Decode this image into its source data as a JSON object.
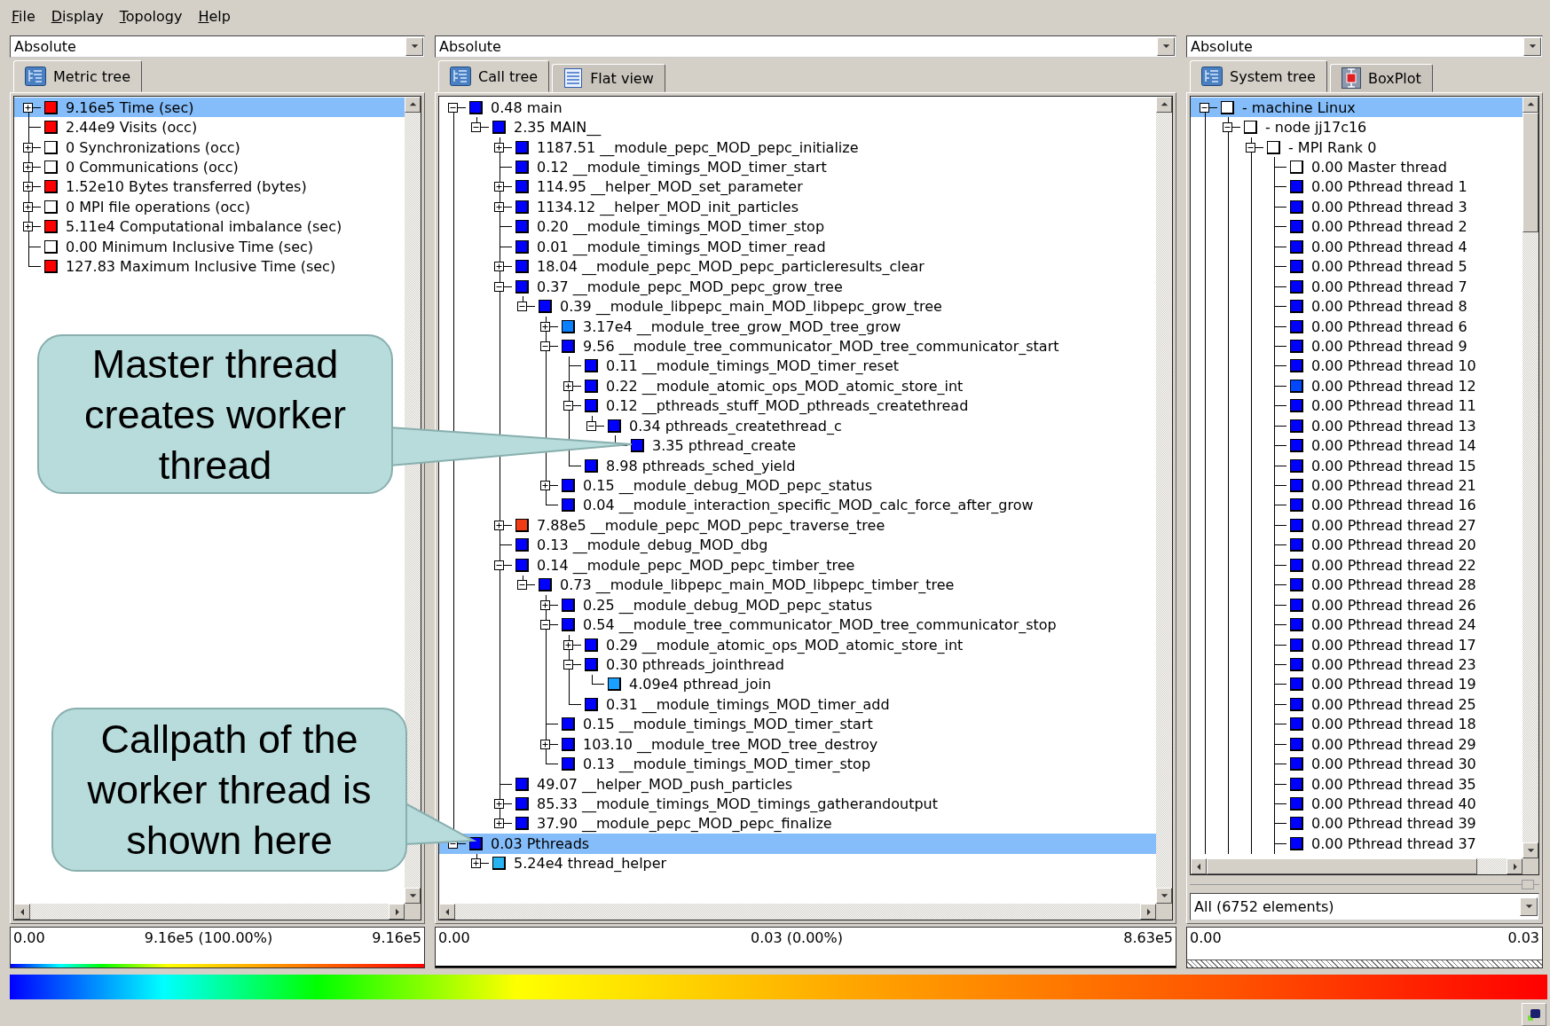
{
  "menu": [
    "File",
    "Display",
    "Topology",
    "Help"
  ],
  "panels": [
    {
      "dropdown": "Absolute",
      "tabs": [
        {
          "label": "Metric tree",
          "kind": "tree",
          "selected": true
        }
      ],
      "tree": {
        "clipped": false,
        "nodes": [
          {
            "label": "9.16e5 Time (sec)",
            "color": "#ff0000",
            "selected": true,
            "expanded": false
          },
          {
            "label": "2.44e9 Visits (occ)",
            "color": "#ff0000",
            "selected": false
          },
          {
            "label": "0 Synchronizations (occ)",
            "color": "#ffffff",
            "selected": false,
            "expanded": false
          },
          {
            "label": "0 Communications (occ)",
            "color": "#ffffff",
            "selected": false,
            "expanded": false
          },
          {
            "label": "1.52e10 Bytes transferred (bytes)",
            "color": "#ff0000",
            "selected": false,
            "expanded": false
          },
          {
            "label": "0 MPI file operations (occ)",
            "color": "#ffffff",
            "selected": false,
            "expanded": false
          },
          {
            "label": "5.11e4 Computational imbalance (sec)",
            "color": "#ff0000",
            "selected": false,
            "expanded": false
          },
          {
            "label": "0.00 Minimum Inclusive Time (sec)",
            "color": "#ffffff",
            "selected": false
          },
          {
            "label": "127.83 Maximum Inclusive Time (sec)",
            "color": "#ff0000",
            "selected": false
          }
        ]
      },
      "value_bar": {
        "kind": "gradient",
        "min": "0.00",
        "current": "9.16e5 (100.00%)",
        "max": "9.16e5"
      }
    },
    {
      "dropdown": "Absolute",
      "tabs": [
        {
          "label": "Call tree",
          "kind": "tree",
          "selected": true
        },
        {
          "label": "Flat view",
          "kind": "list",
          "selected": false
        }
      ],
      "tree": {
        "clipped": false,
        "nodes": [
          {
            "label": "0.48 main",
            "color": "#0000ff",
            "selected": false,
            "expanded": true,
            "children": [
              {
                "label": "2.35 MAIN__",
                "color": "#0000ff",
                "selected": false,
                "expanded": true,
                "children": [
                  {
                    "label": "1187.51 __module_pepc_MOD_pepc_initialize",
                    "color": "#0000ff",
                    "selected": false,
                    "expanded": false
                  },
                  {
                    "label": "0.12 __module_timings_MOD_timer_start",
                    "color": "#0000ff",
                    "selected": false
                  },
                  {
                    "label": "114.95 __helper_MOD_set_parameter",
                    "color": "#0000ff",
                    "selected": false,
                    "expanded": false
                  },
                  {
                    "label": "1134.12 __helper_MOD_init_particles",
                    "color": "#0000ff",
                    "selected": false,
                    "expanded": false
                  },
                  {
                    "label": "0.20 __module_timings_MOD_timer_stop",
                    "color": "#0000ff",
                    "selected": false
                  },
                  {
                    "label": "0.01 __module_timings_MOD_timer_read",
                    "color": "#0000ff",
                    "selected": false
                  },
                  {
                    "label": "18.04 __module_pepc_MOD_pepc_particleresults_clear",
                    "color": "#0000ff",
                    "selected": false,
                    "expanded": false
                  },
                  {
                    "label": "0.37 __module_pepc_MOD_pepc_grow_tree",
                    "color": "#0000ff",
                    "selected": false,
                    "expanded": true,
                    "children": [
                      {
                        "label": "0.39 __module_libpepc_main_MOD_libpepc_grow_tree",
                        "color": "#0000ff",
                        "selected": false,
                        "expanded": true,
                        "children": [
                          {
                            "label": "3.17e4 __module_tree_grow_MOD_tree_grow",
                            "color": "#0a80ff",
                            "selected": false,
                            "expanded": false
                          },
                          {
                            "label": "9.56 __module_tree_communicator_MOD_tree_communicator_start",
                            "color": "#0000ff",
                            "selected": false,
                            "expanded": true,
                            "children": [
                              {
                                "label": "0.11 __module_timings_MOD_timer_reset",
                                "color": "#0000ff",
                                "selected": false
                              },
                              {
                                "label": "0.22 __module_atomic_ops_MOD_atomic_store_int",
                                "color": "#0000ff",
                                "selected": false,
                                "expanded": false
                              },
                              {
                                "label": "0.12 __pthreads_stuff_MOD_pthreads_createthread",
                                "color": "#0000ff",
                                "selected": false,
                                "expanded": true,
                                "children": [
                                  {
                                    "label": "0.34 pthreads_createthread_c",
                                    "color": "#0000ff",
                                    "selected": false,
                                    "expanded": true,
                                    "children": [
                                      {
                                        "label": "3.35 pthread_create",
                                        "color": "#0000ff",
                                        "selected": false
                                      }
                                    ]
                                  }
                                ]
                              },
                              {
                                "label": "8.98 pthreads_sched_yield",
                                "color": "#0000ff",
                                "selected": false
                              }
                            ]
                          },
                          {
                            "label": "0.15 __module_debug_MOD_pepc_status",
                            "color": "#0000ff",
                            "selected": false,
                            "expanded": false
                          },
                          {
                            "label": "0.04 __module_interaction_specific_MOD_calc_force_after_grow",
                            "color": "#0000ff",
                            "selected": false
                          }
                        ]
                      }
                    ]
                  },
                  {
                    "label": "7.88e5 __module_pepc_MOD_pepc_traverse_tree",
                    "color": "#f03c14",
                    "selected": false,
                    "expanded": false
                  },
                  {
                    "label": "0.13 __module_debug_MOD_dbg",
                    "color": "#0000ff",
                    "selected": false
                  },
                  {
                    "label": "0.14 __module_pepc_MOD_pepc_timber_tree",
                    "color": "#0000ff",
                    "selected": false,
                    "expanded": true,
                    "children": [
                      {
                        "label": "0.73 __module_libpepc_main_MOD_libpepc_timber_tree",
                        "color": "#0000ff",
                        "selected": false,
                        "expanded": true,
                        "children": [
                          {
                            "label": "0.25 __module_debug_MOD_pepc_status",
                            "color": "#0000ff",
                            "selected": false,
                            "expanded": false
                          },
                          {
                            "label": "0.54 __module_tree_communicator_MOD_tree_communicator_stop",
                            "color": "#0000ff",
                            "selected": false,
                            "expanded": true,
                            "children": [
                              {
                                "label": "0.29 __module_atomic_ops_MOD_atomic_store_int",
                                "color": "#0000ff",
                                "selected": false,
                                "expanded": false
                              },
                              {
                                "label": "0.30 pthreads_jointhread",
                                "color": "#0000ff",
                                "selected": false,
                                "expanded": true,
                                "children": [
                                  {
                                    "label": "4.09e4 pthread_join",
                                    "color": "#1aa0ff",
                                    "selected": false
                                  }
                                ]
                              },
                              {
                                "label": "0.31 __module_timings_MOD_timer_add",
                                "color": "#0000ff",
                                "selected": false
                              }
                            ]
                          },
                          {
                            "label": "0.15 __module_timings_MOD_timer_start",
                            "color": "#0000ff",
                            "selected": false
                          },
                          {
                            "label": "103.10 __module_tree_MOD_tree_destroy",
                            "color": "#0000ff",
                            "selected": false,
                            "expanded": false
                          },
                          {
                            "label": "0.13 __module_timings_MOD_timer_stop",
                            "color": "#0000ff",
                            "selected": false
                          }
                        ]
                      }
                    ]
                  },
                  {
                    "label": "49.07 __helper_MOD_push_particles",
                    "color": "#0000ff",
                    "selected": false
                  },
                  {
                    "label": "85.33 __module_timings_MOD_timings_gatherandoutput",
                    "color": "#0000ff",
                    "selected": false,
                    "expanded": false
                  },
                  {
                    "label": "37.90 __module_pepc_MOD_pepc_finalize",
                    "color": "#0000ff",
                    "selected": false,
                    "expanded": false
                  }
                ]
              }
            ]
          },
          {
            "label": "0.03 Pthreads",
            "color": "#0000ff",
            "selected": true,
            "expanded": true,
            "children": [
              {
                "label": "5.24e4 thread_helper",
                "color": "#28b4f0",
                "selected": false,
                "expanded": false
              }
            ]
          }
        ]
      },
      "value_bar": {
        "kind": "line",
        "min": "0.00",
        "current": "0.03 (0.00%)",
        "max": "8.63e5"
      }
    },
    {
      "dropdown": "Absolute",
      "tabs": [
        {
          "label": "System tree",
          "kind": "tree",
          "selected": true
        },
        {
          "label": "BoxPlot",
          "kind": "boxplot",
          "selected": false
        }
      ],
      "tree": {
        "clipped": true,
        "nodes": [
          {
            "label": "- machine Linux",
            "color": "#ffffff",
            "selected": true,
            "expanded": true,
            "children": [
              {
                "label": "- node jj17c16",
                "color": "#ffffff",
                "selected": false,
                "expanded": true,
                "children": [
                  {
                    "label": "- MPI Rank 0",
                    "color": "#ffffff",
                    "selected": false,
                    "expanded": true,
                    "children": [
                      {
                        "label": "0.00 Master thread",
                        "color": "#ffffff",
                        "selected": false
                      },
                      {
                        "label": "0.00 Pthread thread 1",
                        "color": "#0000ff",
                        "selected": false
                      },
                      {
                        "label": "0.00 Pthread thread 3",
                        "color": "#0000ff",
                        "selected": false
                      },
                      {
                        "label": "0.00 Pthread thread 2",
                        "color": "#0000ff",
                        "selected": false
                      },
                      {
                        "label": "0.00 Pthread thread 4",
                        "color": "#0000ff",
                        "selected": false
                      },
                      {
                        "label": "0.00 Pthread thread 5",
                        "color": "#0000ff",
                        "selected": false
                      },
                      {
                        "label": "0.00 Pthread thread 7",
                        "color": "#0000ff",
                        "selected": false
                      },
                      {
                        "label": "0.00 Pthread thread 8",
                        "color": "#0000ff",
                        "selected": false
                      },
                      {
                        "label": "0.00 Pthread thread 6",
                        "color": "#0000ff",
                        "selected": false
                      },
                      {
                        "label": "0.00 Pthread thread 9",
                        "color": "#0000ff",
                        "selected": false
                      },
                      {
                        "label": "0.00 Pthread thread 10",
                        "color": "#0000ff",
                        "selected": false
                      },
                      {
                        "label": "0.00 Pthread thread 12",
                        "color": "#0048ff",
                        "selected": false
                      },
                      {
                        "label": "0.00 Pthread thread 11",
                        "color": "#0000ff",
                        "selected": false
                      },
                      {
                        "label": "0.00 Pthread thread 13",
                        "color": "#0000ff",
                        "selected": false
                      },
                      {
                        "label": "0.00 Pthread thread 14",
                        "color": "#0000ff",
                        "selected": false
                      },
                      {
                        "label": "0.00 Pthread thread 15",
                        "color": "#0000ff",
                        "selected": false
                      },
                      {
                        "label": "0.00 Pthread thread 21",
                        "color": "#0000ff",
                        "selected": false
                      },
                      {
                        "label": "0.00 Pthread thread 16",
                        "color": "#0000ff",
                        "selected": false
                      },
                      {
                        "label": "0.00 Pthread thread 27",
                        "color": "#0000ff",
                        "selected": false
                      },
                      {
                        "label": "0.00 Pthread thread 20",
                        "color": "#0000ff",
                        "selected": false
                      },
                      {
                        "label": "0.00 Pthread thread 22",
                        "color": "#0000ff",
                        "selected": false
                      },
                      {
                        "label": "0.00 Pthread thread 28",
                        "color": "#0000ff",
                        "selected": false
                      },
                      {
                        "label": "0.00 Pthread thread 26",
                        "color": "#0000ff",
                        "selected": false
                      },
                      {
                        "label": "0.00 Pthread thread 24",
                        "color": "#0000ff",
                        "selected": false
                      },
                      {
                        "label": "0.00 Pthread thread 17",
                        "color": "#0000ff",
                        "selected": false
                      },
                      {
                        "label": "0.00 Pthread thread 23",
                        "color": "#0000ff",
                        "selected": false
                      },
                      {
                        "label": "0.00 Pthread thread 19",
                        "color": "#0000ff",
                        "selected": false
                      },
                      {
                        "label": "0.00 Pthread thread 25",
                        "color": "#0000ff",
                        "selected": false
                      },
                      {
                        "label": "0.00 Pthread thread 18",
                        "color": "#0000ff",
                        "selected": false
                      },
                      {
                        "label": "0.00 Pthread thread 29",
                        "color": "#0000ff",
                        "selected": false
                      },
                      {
                        "label": "0.00 Pthread thread 30",
                        "color": "#0000ff",
                        "selected": false
                      },
                      {
                        "label": "0.00 Pthread thread 35",
                        "color": "#0000ff",
                        "selected": false
                      },
                      {
                        "label": "0.00 Pthread thread 40",
                        "color": "#0000ff",
                        "selected": false
                      },
                      {
                        "label": "0.00 Pthread thread 39",
                        "color": "#0000ff",
                        "selected": false
                      },
                      {
                        "label": "0.00 Pthread thread 37",
                        "color": "#0000ff",
                        "selected": false
                      }
                    ]
                  }
                ]
              }
            ]
          }
        ]
      },
      "filter": "All (6752 elements)",
      "value_bar": {
        "kind": "hatched",
        "min": "0.00",
        "max": "0.03"
      }
    }
  ],
  "callouts": [
    {
      "text": "Master thread creates worker thread"
    },
    {
      "text": "Callpath of the worker thread is shown here"
    }
  ]
}
